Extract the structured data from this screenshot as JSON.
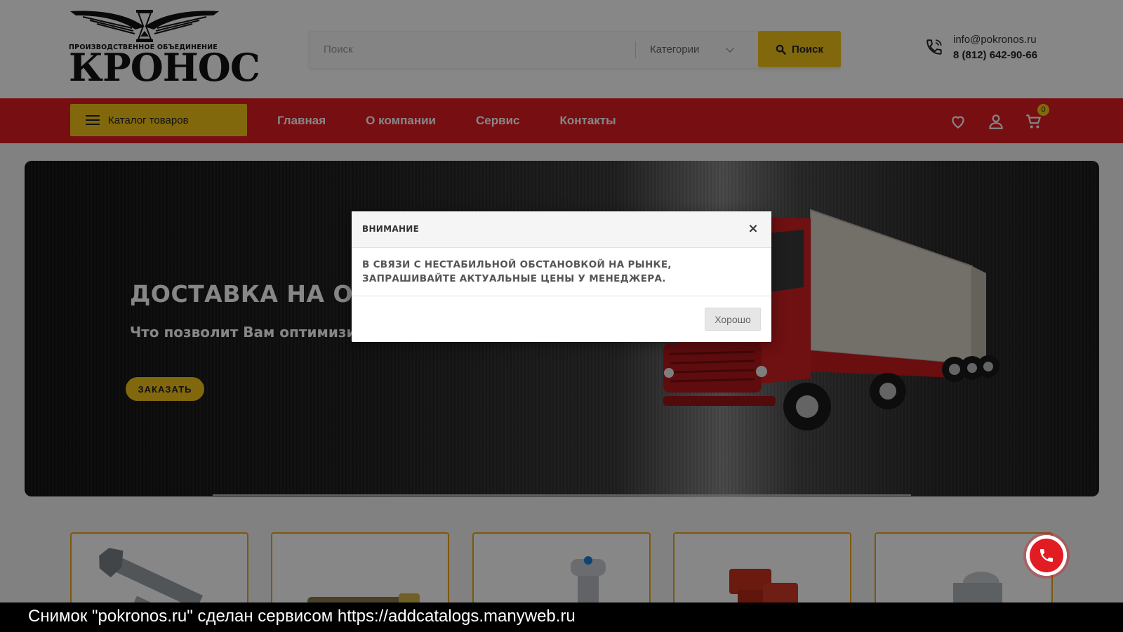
{
  "header": {
    "logo": {
      "subtitle": "ПРОИЗВОДСТВЕННОЕ ОБЪЕДИНЕНИЕ",
      "brand": "КРОНОС"
    },
    "search": {
      "placeholder": "Поиск",
      "category_label": "Категории",
      "button_label": "Поиск"
    },
    "contact": {
      "email": "info@pokronos.ru",
      "phone": "8 (812) 642-90-66"
    }
  },
  "nav": {
    "catalog_label": "Каталог товаров",
    "links": [
      "Главная",
      "О компании",
      "Сервис",
      "Контакты"
    ],
    "cart_count": "0"
  },
  "banner": {
    "title": "ДОСТАВКА НА ОБ",
    "subtitle": "Что позволит Вам оптимизи расходы",
    "button_label": "ЗАКАЗАТЬ"
  },
  "modal": {
    "title": "ВНИМАНИЕ",
    "close_symbol": "×",
    "message": "В СВЯЗИ С НЕСТАБИЛЬНОЙ ОБСТАНОВКОЙ НА РЫНКЕ, ЗАПРАШИВАЙТЕ АКТУАЛЬНЫЕ ЦЕНЫ У МЕНЕДЖЕРА.",
    "ok_label": "Хорошо"
  },
  "watermark": "Снимок \"pokronos.ru\" сделан сервисом https://addcatalogs.manyweb.ru",
  "colors": {
    "brand_red": "#e11c22",
    "accent_yellow": "#f6c419",
    "card_border": "#f0a419"
  },
  "icons": [
    "phone-icon",
    "search-icon",
    "chevron-down-icon",
    "menu-icon",
    "heart-icon",
    "user-icon",
    "cart-icon",
    "close-icon",
    "call-icon"
  ]
}
